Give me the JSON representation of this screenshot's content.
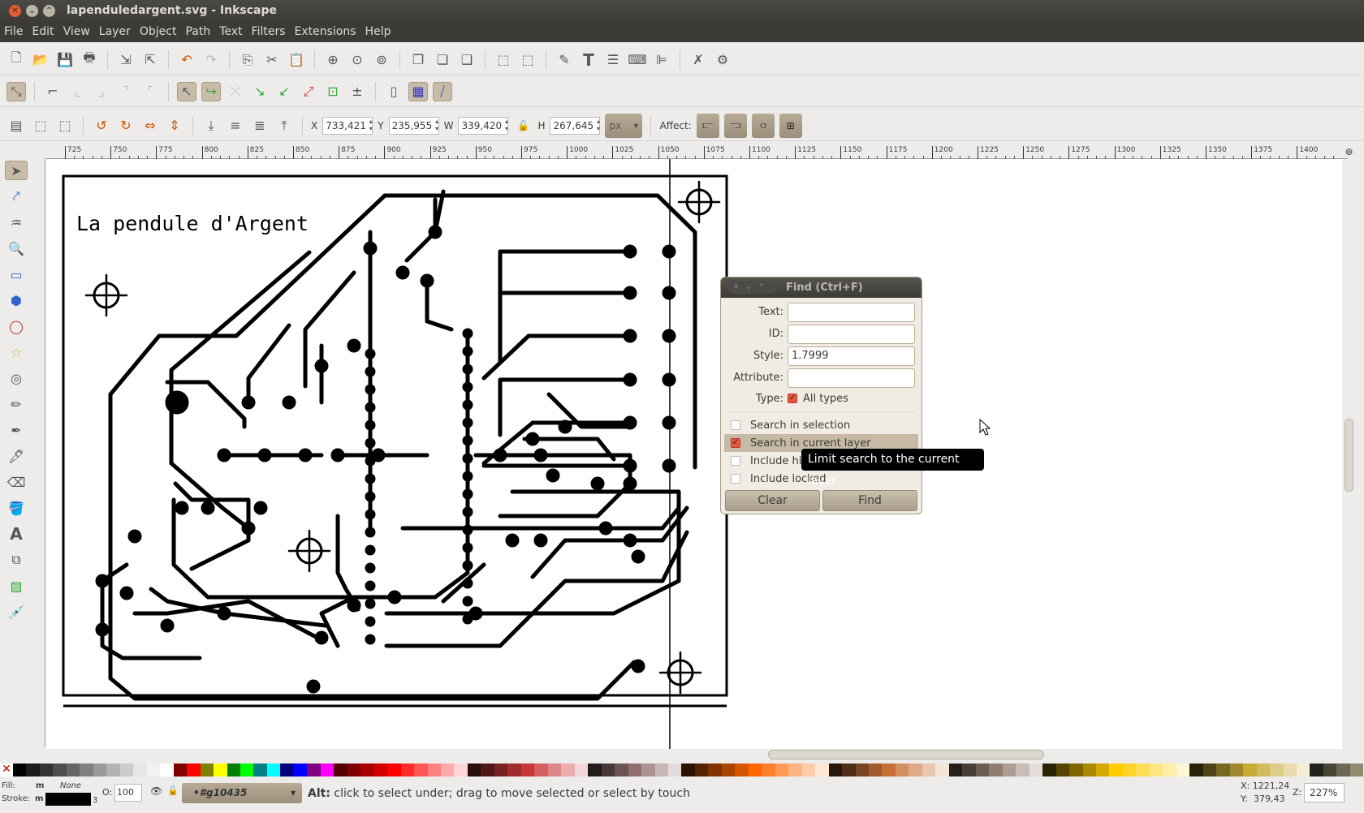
{
  "window": {
    "title": "lapenduledargent.svg - Inkscape"
  },
  "menu": [
    "File",
    "Edit",
    "View",
    "Layer",
    "Object",
    "Path",
    "Text",
    "Filters",
    "Extensions",
    "Help"
  ],
  "selectbar": {
    "x_label": "X",
    "x": "733,421",
    "y_label": "Y",
    "y": "235,955",
    "w_label": "W",
    "w": "339,420",
    "h_label": "H",
    "h": "267,645",
    "unit": "px",
    "affect_label": "Affect:"
  },
  "ruler": [
    "725",
    "750",
    "775",
    "800",
    "825",
    "850",
    "875",
    "900",
    "925",
    "950",
    "975",
    "1000",
    "1025",
    "1050",
    "1075",
    "1100",
    "1125",
    "1150",
    "1175",
    "1200",
    "1225",
    "1250",
    "1275",
    "1300",
    "1325",
    "1350",
    "1375",
    "1400"
  ],
  "canvas": {
    "title_text": "La pendule d'Argent"
  },
  "find": {
    "title": "Find (Ctrl+F)",
    "text_label": "Text:",
    "text_value": "",
    "id_label": "ID:",
    "id_value": "",
    "style_label": "Style:",
    "style_value": "1.7999",
    "attribute_label": "Attribute:",
    "attribute_value": "",
    "type_label": "Type:",
    "all_types": "All types",
    "all_types_checked": true,
    "options": [
      {
        "label": "Search in selection",
        "checked": false
      },
      {
        "label": "Search in current layer",
        "checked": true
      },
      {
        "label": "Include hidden",
        "checked": false
      },
      {
        "label": "Include locked",
        "checked": false
      }
    ],
    "clear": "Clear",
    "find": "Find"
  },
  "tooltip": "Limit search to the current layer",
  "status": {
    "fill_label": "Fill:",
    "fill_value": "m",
    "fill_none": "None",
    "stroke_label": "Stroke:",
    "stroke_value": "m",
    "stroke_width": "3",
    "opacity_label": "O:",
    "opacity": "100",
    "layer": "•#g10435",
    "message_bold": "Alt:",
    "message": " click to select under; drag to move selected or select by touch",
    "cx": "X: 1221,24",
    "cy": "Y:  379,43",
    "zoom_label": "Z:",
    "zoom": "227%"
  },
  "palette": [
    "#000000",
    "#1a1a1a",
    "#333333",
    "#4d4d4d",
    "#666666",
    "#808080",
    "#999999",
    "#b3b3b3",
    "#cccccc",
    "#e6e6e6",
    "#f2f2f2",
    "#ffffff",
    "#800000",
    "#ff0000",
    "#808000",
    "#ffff00",
    "#008000",
    "#00ff00",
    "#008080",
    "#00ffff",
    "#000080",
    "#0000ff",
    "#800080",
    "#ff00ff",
    "#550000",
    "#800000",
    "#aa0000",
    "#d40000",
    "#ff0000",
    "#ff2a2a",
    "#ff5555",
    "#ff8080",
    "#ffaaaa",
    "#ffd5d5",
    "#280b0b",
    "#501616",
    "#782121",
    "#a02c2c",
    "#c83737",
    "#d35f5f",
    "#de8787",
    "#e9afaf",
    "#f4d7d7",
    "#241c1c",
    "#483737",
    "#6c5353",
    "#916f6f",
    "#ac9393",
    "#c8b7b7",
    "#e3dbdb",
    "#2b1100",
    "#552200",
    "#803300",
    "#aa4400",
    "#d45500",
    "#ff6600",
    "#ff7f2a",
    "#ff9955",
    "#ffb380",
    "#ffccaa",
    "#ffe6d5",
    "#28170b",
    "#502d16",
    "#784421",
    "#a05a2c",
    "#c87137",
    "#d38d5f",
    "#deaa87",
    "#e9c6af",
    "#f4e3d7",
    "#241f1c",
    "#483e37",
    "#6c5d53",
    "#917c6f",
    "#ac9d93",
    "#c8beb7",
    "#e3dedb",
    "#2b2200",
    "#554400",
    "#806600",
    "#aa8800",
    "#d4aa00",
    "#ffcc00",
    "#ffd42a",
    "#ffdd55",
    "#ffe680",
    "#ffeeaa",
    "#fff6d5",
    "#28220b",
    "#504416",
    "#786721",
    "#a0892c",
    "#c8ab37",
    "#d3bc5f",
    "#decd87",
    "#e9ddaf",
    "#f4eed7",
    "#24221c",
    "#484537",
    "#6c6753",
    "#918a6f"
  ]
}
